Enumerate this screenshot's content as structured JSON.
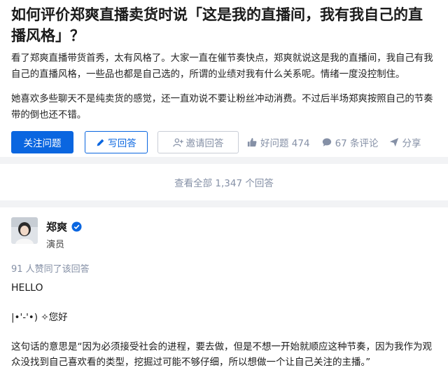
{
  "question": {
    "title": "如何评价郑爽直播卖货时说「这是我的直播间，我有我自己的直播风格」？",
    "desc_p1": "看了郑爽直播带货首秀，太有风格了。大家一直在催节奏快点，郑爽就说这是我的直播间，我自己有我自己的直播风格，一些品也都是自己选的，所谓的业绩对我有什么关系呢。情绪一度没控制住。",
    "desc_p2": "她喜欢多些聊天不是纯卖货的感觉，还一直劝说不要让粉丝冲动消费。不过后半场郑爽按照自己的节奏带的倒也还不错。",
    "follow_label": "关注问题",
    "write_label": "写回答",
    "invite_label": "邀请回答",
    "good_label": "好问题 474",
    "comment_label": "67 条评论",
    "share_label": "分享"
  },
  "view_all_label": "查看全部 1,347 个回答",
  "answer": {
    "author_name": "郑爽",
    "author_bio": "演员",
    "upvote_text": "91 人赞同了该回答",
    "hello": "HELLO",
    "kaomoji": "|•'-'•) ✧您好",
    "para": "这句话的意思是“因为必须接受社会的进程，要去做，但是不想一开始就顺应这种节奏，因为我作为观众没找到自己喜欢看的类型，挖掘过可能不够仔细，所以想做一个让自己关注的主播。”"
  },
  "colors": {
    "brand_blue": "#0a66e0",
    "meta_gray": "#8590a6",
    "divider": "#f2f3f5"
  },
  "icons": {
    "write": "pencil-icon",
    "invite": "add-user-icon",
    "good": "thumb-up-icon",
    "comment": "comment-bubble-icon",
    "share": "paper-plane-icon",
    "verify": "verified-badge-icon"
  }
}
